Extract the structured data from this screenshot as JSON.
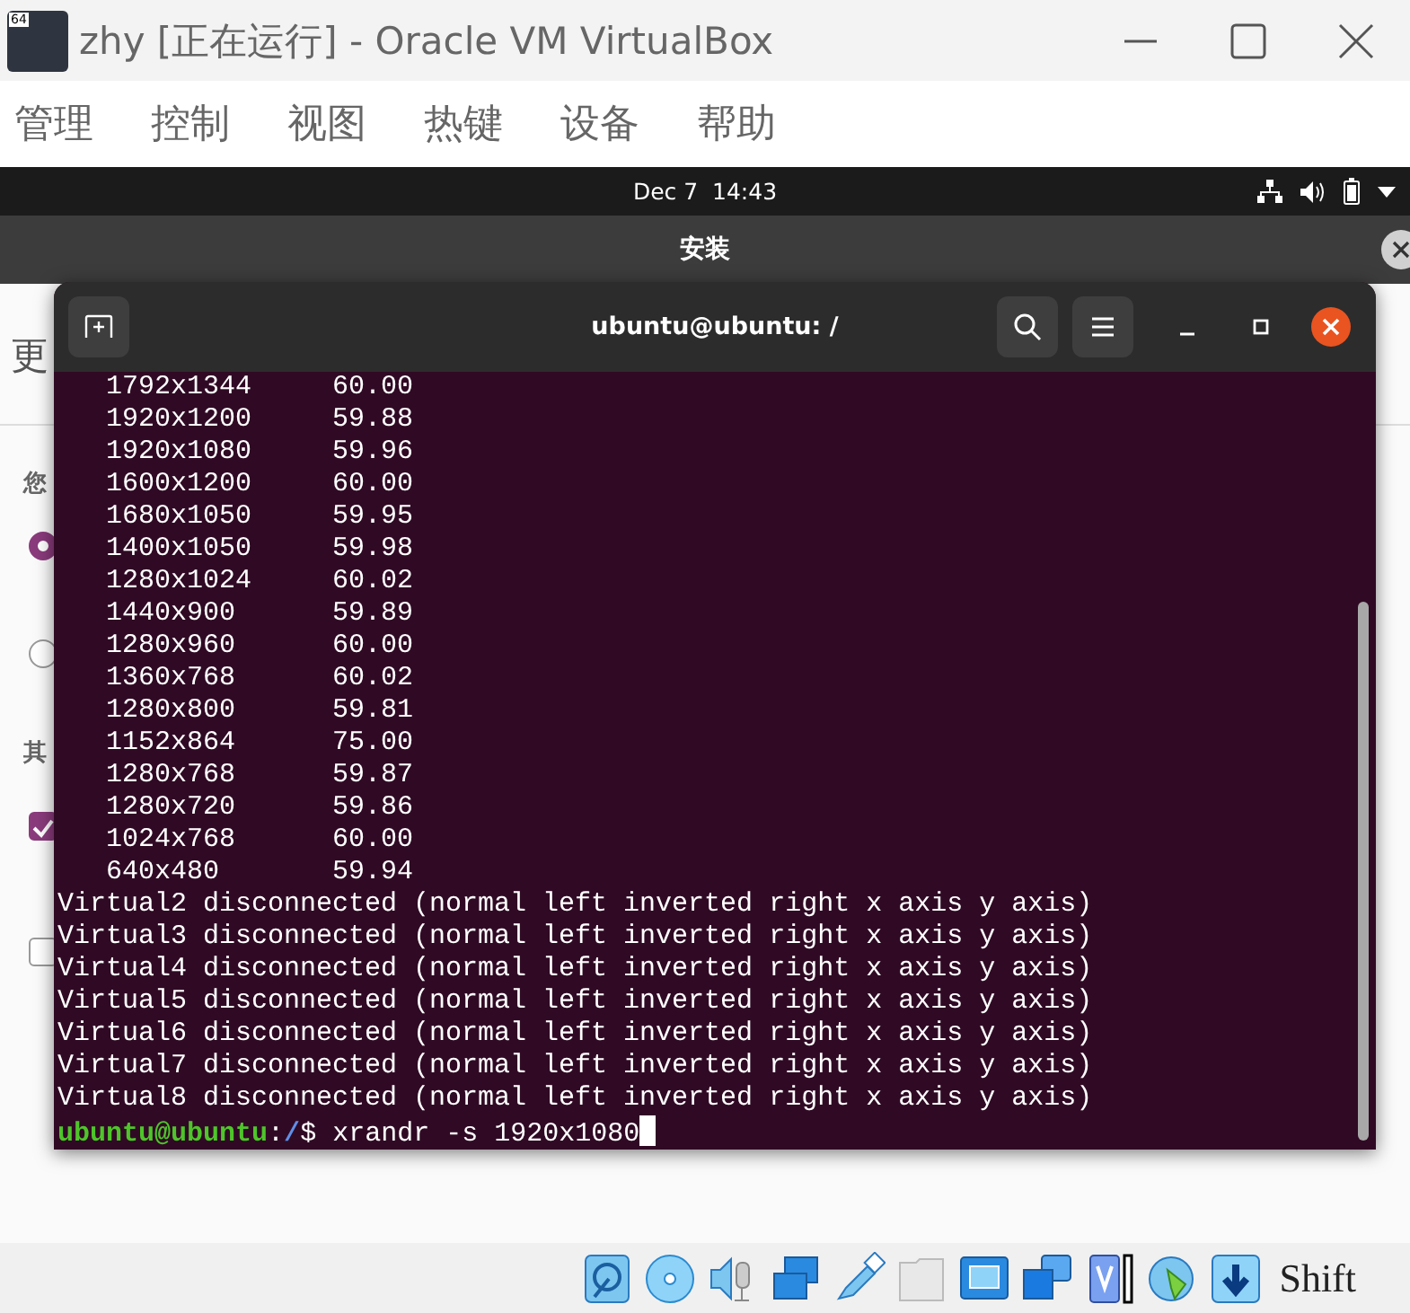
{
  "window": {
    "title": "zhy [正在运行] - Oracle VM VirtualBox",
    "icon_badge": "64"
  },
  "menu": [
    "管理",
    "控制",
    "视图",
    "热键",
    "设备",
    "帮助"
  ],
  "top_bar": {
    "clock": "Dec 7  14:43"
  },
  "installer": {
    "title": "安装",
    "heading": "更",
    "label_1": "您",
    "label_2": "其",
    "radios": [
      {
        "selected": true
      },
      {
        "selected": false
      }
    ],
    "checkboxes": [
      {
        "checked": true
      },
      {
        "checked": false
      }
    ]
  },
  "terminal": {
    "title": "ubuntu@ubuntu: /",
    "modes": [
      {
        "resolution": "1792x1344",
        "rate": "60.00"
      },
      {
        "resolution": "1920x1200",
        "rate": "59.88"
      },
      {
        "resolution": "1920x1080",
        "rate": "59.96"
      },
      {
        "resolution": "1600x1200",
        "rate": "60.00"
      },
      {
        "resolution": "1680x1050",
        "rate": "59.95"
      },
      {
        "resolution": "1400x1050",
        "rate": "59.98"
      },
      {
        "resolution": "1280x1024",
        "rate": "60.02"
      },
      {
        "resolution": "1440x900",
        "rate": "59.89"
      },
      {
        "resolution": "1280x960",
        "rate": "60.00"
      },
      {
        "resolution": "1360x768",
        "rate": "60.02"
      },
      {
        "resolution": "1280x800",
        "rate": "59.81"
      },
      {
        "resolution": "1152x864",
        "rate": "75.00"
      },
      {
        "resolution": "1280x768",
        "rate": "59.87"
      },
      {
        "resolution": "1280x720",
        "rate": "59.86"
      },
      {
        "resolution": "1024x768",
        "rate": "60.00"
      },
      {
        "resolution": "640x480",
        "rate": "59.94"
      }
    ],
    "output": [
      "Virtual2 disconnected (normal left inverted right x axis y axis)",
      "Virtual3 disconnected (normal left inverted right x axis y axis)",
      "Virtual4 disconnected (normal left inverted right x axis y axis)",
      "Virtual5 disconnected (normal left inverted right x axis y axis)",
      "Virtual6 disconnected (normal left inverted right x axis y axis)",
      "Virtual7 disconnected (normal left inverted right x axis y axis)",
      "Virtual8 disconnected (normal left inverted right x axis y axis)"
    ],
    "prompt": {
      "user": "ubuntu@ubuntu",
      "separator": ":",
      "path": "/",
      "symbol": "$",
      "command": "xrandr -s 1920x1080"
    }
  },
  "status_bar": {
    "host_key": "Shift"
  }
}
